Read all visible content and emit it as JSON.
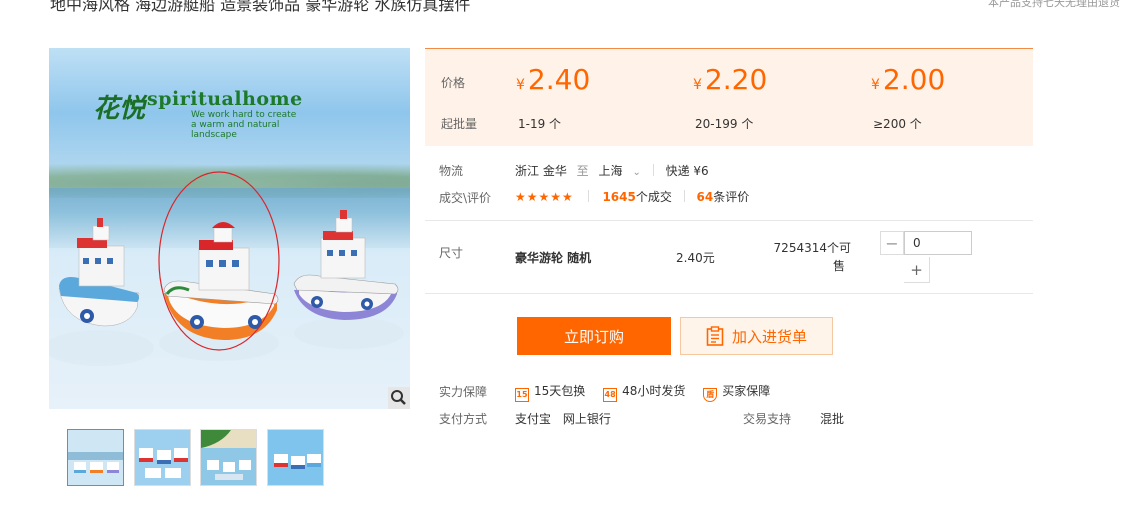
{
  "product": {
    "title": "地中海风格 海边游艇船 造景装饰品 豪华游轮 水族仿真摆件",
    "notice": "本产品支持七天无理由退货"
  },
  "gallery": {
    "brand_name": "spiritualhome",
    "brand_cn": "花悦",
    "brand_sub1": "We work hard to create",
    "brand_sub2": "a warm and natural",
    "brand_sub3": "landscape",
    "zoom_icon": "magnifier-icon",
    "thumbnails": 4,
    "active_thumbnail": 1
  },
  "pricing": {
    "price_label": "价格",
    "moq_label": "起批量",
    "currency": "¥",
    "tiers": [
      {
        "price": "2.40",
        "range": "1-19 个"
      },
      {
        "price": "2.20",
        "range": "20-199 个"
      },
      {
        "price": "2.00",
        "range": "≥200 个"
      }
    ]
  },
  "logistics": {
    "label": "物流",
    "from": "浙江 金华",
    "to_word": "至",
    "to": "上海",
    "shipping": "快递 ¥6"
  },
  "deals": {
    "label": "成交\\评价",
    "stars": "★★★★★",
    "sold_count": "1645",
    "sold_suffix": "个成交",
    "review_count": "64",
    "review_suffix": "条评价"
  },
  "sku": {
    "label": "尺寸",
    "name": "豪华游轮 随机",
    "price": "2.40元",
    "stock_line1": "7254314个可",
    "stock_line2": "售",
    "minus": "−",
    "plus": "+",
    "quantity": "0"
  },
  "actions": {
    "buy_label": "立即订购",
    "cart_label": "加入进货单"
  },
  "guarantee": {
    "label": "实力保障",
    "items": [
      {
        "icon": "15",
        "text": "15天包换"
      },
      {
        "icon": "48",
        "text": "48小时发货"
      },
      {
        "icon": "盾",
        "text": "买家保障"
      }
    ]
  },
  "payment": {
    "label": "支付方式",
    "methods": [
      "支付宝",
      "网上银行"
    ],
    "trade_label": "交易支持",
    "trade_value": "混批"
  },
  "colors": {
    "accent": "#ff6600",
    "price_bg": "#fff2e8"
  }
}
